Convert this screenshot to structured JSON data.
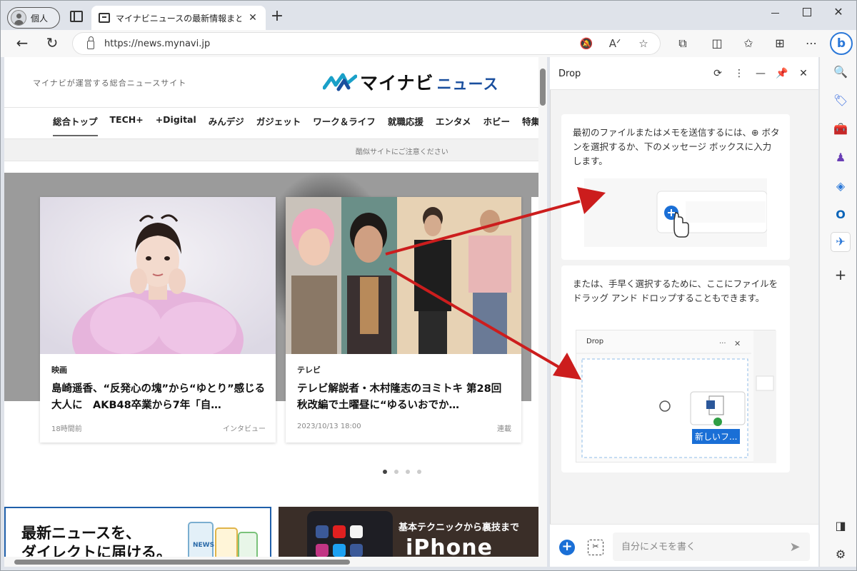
{
  "browser": {
    "profile_label": "個人",
    "tab_title": "マイナビニュースの最新情報まとめ - エ",
    "url": "https://news.mynavi.jp"
  },
  "site": {
    "tagline": "マイナビが運営する総合ニュースサイト",
    "logo_text": "マイナビ",
    "logo_text2": "ニュース",
    "nav": [
      "総合トップ",
      "TECH+",
      "+Digital",
      "みんデジ",
      "ガジェット",
      "ワーク＆ライフ",
      "就職応援",
      "エンタメ",
      "ホビー",
      "特集"
    ],
    "notice": "酷似サイトにご注意ください",
    "cards": [
      {
        "category": "映画",
        "title": "島崎遥香、“反発心の塊”から“ゆとり”感じる大人に　AKB48卒業から7年「自…",
        "date": "18時間前",
        "tag": "インタビュー"
      },
      {
        "category": "テレビ",
        "title": "テレビ解説者・木村隆志のヨミトキ 第28回 秋改編で土曜昼に“ゆるいおでか…",
        "date": "2023/10/13 18:00",
        "tag": "連載"
      }
    ],
    "promo1": {
      "line1": "最新ニュースを、",
      "line2": "ダイレクトに届ける。"
    },
    "promo2": {
      "sub": "基本テクニックから裏技まで",
      "main": "iPhone"
    }
  },
  "drop": {
    "title": "Drop",
    "card1_text": "最初のファイルまたはメモを送信するには、⊕ ボタンを選択するか、下のメッセージ ボックスに入力します。",
    "card2_text": "または、手早く選択するために、ここにファイルをドラッグ アンド ドロップすることもできます。",
    "illus2_title": "Drop",
    "illus2_file_label": "新しいフ...",
    "input_placeholder": "自分にメモを書く"
  },
  "colors": {
    "accent_blue": "#1a6fd6",
    "arrow_red": "#cc1d1d",
    "logo_blue": "#1a4f9e"
  }
}
